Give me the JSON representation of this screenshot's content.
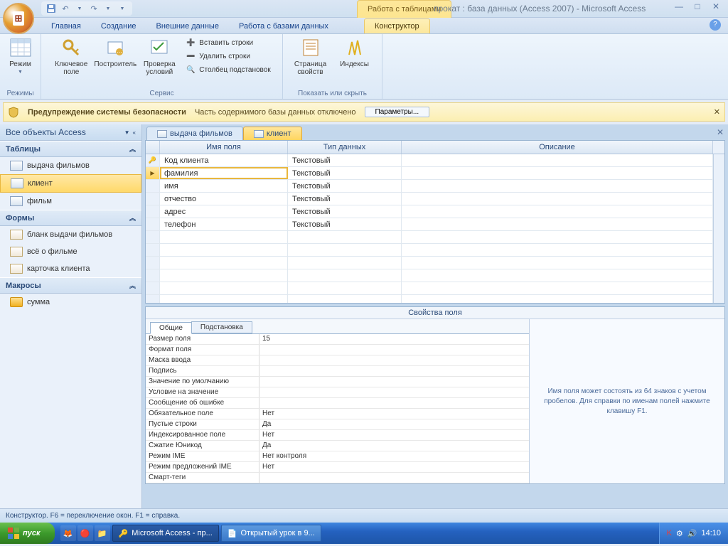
{
  "titlebar": {
    "contextual": "Работа с таблицами",
    "title": "прокат : база данных (Access 2007) - Microsoft Access"
  },
  "tabs": {
    "home": "Главная",
    "create": "Создание",
    "external": "Внешние данные",
    "dbtools": "Работа с базами данных",
    "design": "Конструктор"
  },
  "ribbon": {
    "mode_group": "Режимы",
    "mode": "Режим",
    "key": "Ключевое поле",
    "builder": "Построитель",
    "validation": "Проверка условий",
    "insert_rows": "Вставить строки",
    "delete_rows": "Удалить строки",
    "lookup_col": "Столбец подстановок",
    "service_group": "Сервис",
    "prop_sheet": "Страница свойств",
    "indexes": "Индексы",
    "showhide_group": "Показать или скрыть"
  },
  "security": {
    "title": "Предупреждение системы безопасности",
    "msg": "Часть содержимого базы данных отключено",
    "btn": "Параметры..."
  },
  "nav": {
    "header": "Все объекты Access",
    "cat_tables": "Таблицы",
    "cat_forms": "Формы",
    "cat_macros": "Макросы",
    "t1": "выдача фильмов",
    "t2": "клиент",
    "t3": "фильм",
    "f1": "бланк выдачи фильмов",
    "f2": "всё о фильме",
    "f3": "карточка клиента",
    "m1": "сумма"
  },
  "doc_tabs": {
    "t1": "выдача фильмов",
    "t2": "клиент"
  },
  "grid": {
    "h_name": "Имя поля",
    "h_type": "Тип данных",
    "h_desc": "Описание",
    "rows": [
      {
        "name": "Код клиента",
        "type": "Текстовый"
      },
      {
        "name": "фамилия",
        "type": "Текстовый"
      },
      {
        "name": "имя",
        "type": "Текстовый"
      },
      {
        "name": "отчество",
        "type": "Текстовый"
      },
      {
        "name": "адрес",
        "type": "Текстовый"
      },
      {
        "name": "телефон",
        "type": "Текстовый"
      }
    ]
  },
  "props": {
    "title": "Свойства поля",
    "tab_general": "Общие",
    "tab_lookup": "Подстановка",
    "rows": [
      {
        "l": "Размер поля",
        "v": "15"
      },
      {
        "l": "Формат поля",
        "v": ""
      },
      {
        "l": "Маска ввода",
        "v": ""
      },
      {
        "l": "Подпись",
        "v": ""
      },
      {
        "l": "Значение по умолчанию",
        "v": ""
      },
      {
        "l": "Условие на значение",
        "v": ""
      },
      {
        "l": "Сообщение об ошибке",
        "v": ""
      },
      {
        "l": "Обязательное поле",
        "v": "Нет"
      },
      {
        "l": "Пустые строки",
        "v": "Да"
      },
      {
        "l": "Индексированное поле",
        "v": "Нет"
      },
      {
        "l": "Сжатие Юникод",
        "v": "Да"
      },
      {
        "l": "Режим IME",
        "v": "Нет контроля"
      },
      {
        "l": "Режим предложений IME",
        "v": "Нет"
      },
      {
        "l": "Смарт-теги",
        "v": ""
      }
    ],
    "help": "Имя поля может состоять из 64 знаков с учетом пробелов.  Для справки по именам полей нажмите клавишу F1."
  },
  "statusbar": "Конструктор.  F6 = переключение окон.  F1 = справка.",
  "taskbar": {
    "start": "пуск",
    "t1": "Microsoft Access - пр...",
    "t2": "Открытый урок в 9...",
    "clock": "14:10"
  }
}
